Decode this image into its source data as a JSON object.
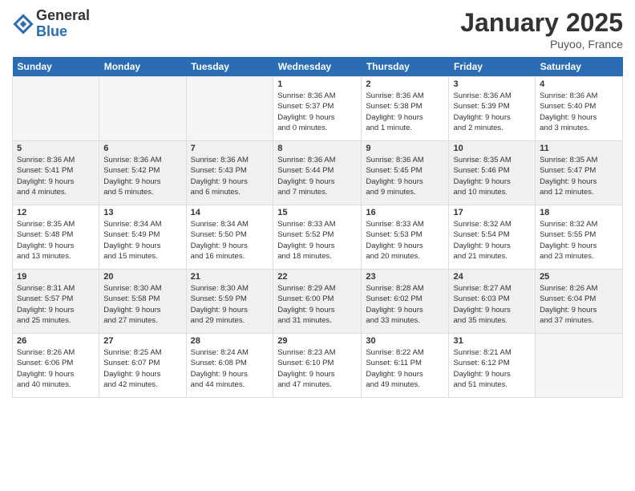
{
  "header": {
    "logo_general": "General",
    "logo_blue": "Blue",
    "month_title": "January 2025",
    "location": "Puyoo, France"
  },
  "weekdays": [
    "Sunday",
    "Monday",
    "Tuesday",
    "Wednesday",
    "Thursday",
    "Friday",
    "Saturday"
  ],
  "weeks": [
    [
      {
        "day": "",
        "info": ""
      },
      {
        "day": "",
        "info": ""
      },
      {
        "day": "",
        "info": ""
      },
      {
        "day": "1",
        "info": "Sunrise: 8:36 AM\nSunset: 5:37 PM\nDaylight: 9 hours\nand 0 minutes."
      },
      {
        "day": "2",
        "info": "Sunrise: 8:36 AM\nSunset: 5:38 PM\nDaylight: 9 hours\nand 1 minute."
      },
      {
        "day": "3",
        "info": "Sunrise: 8:36 AM\nSunset: 5:39 PM\nDaylight: 9 hours\nand 2 minutes."
      },
      {
        "day": "4",
        "info": "Sunrise: 8:36 AM\nSunset: 5:40 PM\nDaylight: 9 hours\nand 3 minutes."
      }
    ],
    [
      {
        "day": "5",
        "info": "Sunrise: 8:36 AM\nSunset: 5:41 PM\nDaylight: 9 hours\nand 4 minutes."
      },
      {
        "day": "6",
        "info": "Sunrise: 8:36 AM\nSunset: 5:42 PM\nDaylight: 9 hours\nand 5 minutes."
      },
      {
        "day": "7",
        "info": "Sunrise: 8:36 AM\nSunset: 5:43 PM\nDaylight: 9 hours\nand 6 minutes."
      },
      {
        "day": "8",
        "info": "Sunrise: 8:36 AM\nSunset: 5:44 PM\nDaylight: 9 hours\nand 7 minutes."
      },
      {
        "day": "9",
        "info": "Sunrise: 8:36 AM\nSunset: 5:45 PM\nDaylight: 9 hours\nand 9 minutes."
      },
      {
        "day": "10",
        "info": "Sunrise: 8:35 AM\nSunset: 5:46 PM\nDaylight: 9 hours\nand 10 minutes."
      },
      {
        "day": "11",
        "info": "Sunrise: 8:35 AM\nSunset: 5:47 PM\nDaylight: 9 hours\nand 12 minutes."
      }
    ],
    [
      {
        "day": "12",
        "info": "Sunrise: 8:35 AM\nSunset: 5:48 PM\nDaylight: 9 hours\nand 13 minutes."
      },
      {
        "day": "13",
        "info": "Sunrise: 8:34 AM\nSunset: 5:49 PM\nDaylight: 9 hours\nand 15 minutes."
      },
      {
        "day": "14",
        "info": "Sunrise: 8:34 AM\nSunset: 5:50 PM\nDaylight: 9 hours\nand 16 minutes."
      },
      {
        "day": "15",
        "info": "Sunrise: 8:33 AM\nSunset: 5:52 PM\nDaylight: 9 hours\nand 18 minutes."
      },
      {
        "day": "16",
        "info": "Sunrise: 8:33 AM\nSunset: 5:53 PM\nDaylight: 9 hours\nand 20 minutes."
      },
      {
        "day": "17",
        "info": "Sunrise: 8:32 AM\nSunset: 5:54 PM\nDaylight: 9 hours\nand 21 minutes."
      },
      {
        "day": "18",
        "info": "Sunrise: 8:32 AM\nSunset: 5:55 PM\nDaylight: 9 hours\nand 23 minutes."
      }
    ],
    [
      {
        "day": "19",
        "info": "Sunrise: 8:31 AM\nSunset: 5:57 PM\nDaylight: 9 hours\nand 25 minutes."
      },
      {
        "day": "20",
        "info": "Sunrise: 8:30 AM\nSunset: 5:58 PM\nDaylight: 9 hours\nand 27 minutes."
      },
      {
        "day": "21",
        "info": "Sunrise: 8:30 AM\nSunset: 5:59 PM\nDaylight: 9 hours\nand 29 minutes."
      },
      {
        "day": "22",
        "info": "Sunrise: 8:29 AM\nSunset: 6:00 PM\nDaylight: 9 hours\nand 31 minutes."
      },
      {
        "day": "23",
        "info": "Sunrise: 8:28 AM\nSunset: 6:02 PM\nDaylight: 9 hours\nand 33 minutes."
      },
      {
        "day": "24",
        "info": "Sunrise: 8:27 AM\nSunset: 6:03 PM\nDaylight: 9 hours\nand 35 minutes."
      },
      {
        "day": "25",
        "info": "Sunrise: 8:26 AM\nSunset: 6:04 PM\nDaylight: 9 hours\nand 37 minutes."
      }
    ],
    [
      {
        "day": "26",
        "info": "Sunrise: 8:26 AM\nSunset: 6:06 PM\nDaylight: 9 hours\nand 40 minutes."
      },
      {
        "day": "27",
        "info": "Sunrise: 8:25 AM\nSunset: 6:07 PM\nDaylight: 9 hours\nand 42 minutes."
      },
      {
        "day": "28",
        "info": "Sunrise: 8:24 AM\nSunset: 6:08 PM\nDaylight: 9 hours\nand 44 minutes."
      },
      {
        "day": "29",
        "info": "Sunrise: 8:23 AM\nSunset: 6:10 PM\nDaylight: 9 hours\nand 47 minutes."
      },
      {
        "day": "30",
        "info": "Sunrise: 8:22 AM\nSunset: 6:11 PM\nDaylight: 9 hours\nand 49 minutes."
      },
      {
        "day": "31",
        "info": "Sunrise: 8:21 AM\nSunset: 6:12 PM\nDaylight: 9 hours\nand 51 minutes."
      },
      {
        "day": "",
        "info": ""
      }
    ]
  ]
}
